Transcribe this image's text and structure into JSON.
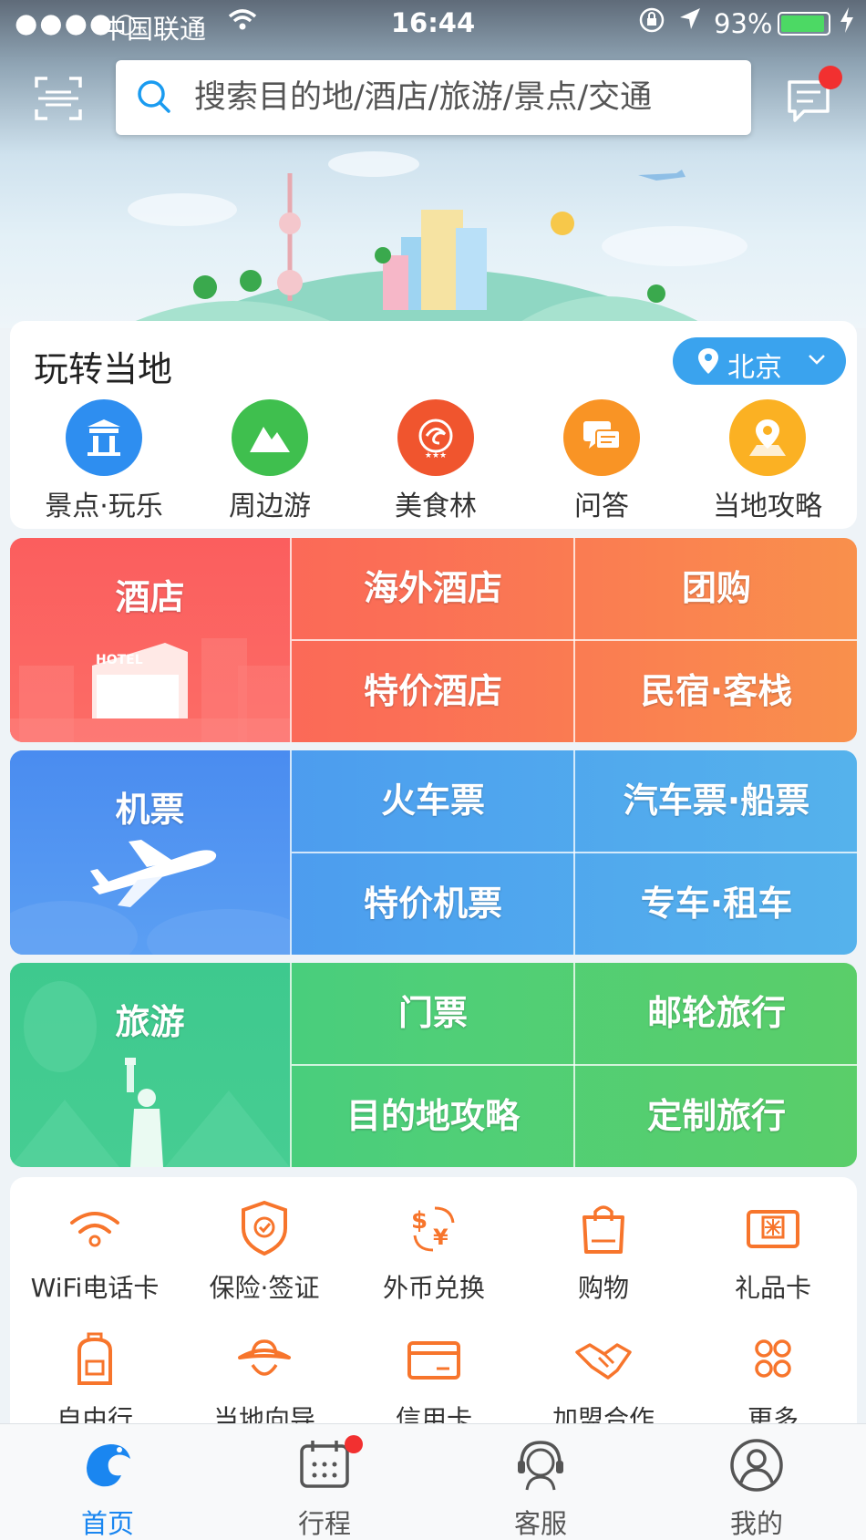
{
  "status_bar": {
    "signal": "●●●●○",
    "carrier": "中国联通",
    "time": "16:44",
    "battery": "93%",
    "battery_level": 0.93
  },
  "header": {
    "search_placeholder": "搜索目的地/酒店/旅游/景点/交通",
    "scan_icon": "scan-icon",
    "message_icon": "message-icon",
    "has_notification": true
  },
  "local": {
    "title": "玩转当地",
    "city": "北京",
    "items": [
      {
        "label": "景点·玩乐",
        "icon": "gate-icon",
        "color": "#2e8ef0"
      },
      {
        "label": "周边游",
        "icon": "mountain-icon",
        "color": "#3fbf4e"
      },
      {
        "label": "美食林",
        "icon": "dolphin-badge-icon",
        "color": "#f0552e"
      },
      {
        "label": "问答",
        "icon": "chat-bubbles-icon",
        "color": "#f99425"
      },
      {
        "label": "当地攻略",
        "icon": "map-pin-icon",
        "color": "#fbb123"
      }
    ]
  },
  "grid": {
    "hotel": {
      "main": "酒店",
      "cells": [
        "海外酒店",
        "团购",
        "特价酒店",
        "民宿·客栈"
      ]
    },
    "flight": {
      "main": "机票",
      "cells": [
        "火车票",
        "汽车票·船票",
        "特价机票",
        "专车·租车"
      ]
    },
    "travel": {
      "main": "旅游",
      "cells": [
        "门票",
        "邮轮旅行",
        "目的地攻略",
        "定制旅行"
      ]
    }
  },
  "services": [
    {
      "label": "WiFi电话卡",
      "icon": "wifi-icon"
    },
    {
      "label": "保险·签证",
      "icon": "shield-icon"
    },
    {
      "label": "外币兑换",
      "icon": "currency-exchange-icon"
    },
    {
      "label": "购物",
      "icon": "shopping-bag-icon"
    },
    {
      "label": "礼品卡",
      "icon": "gift-card-icon"
    },
    {
      "label": "自由行",
      "icon": "backpack-icon"
    },
    {
      "label": "当地向导",
      "icon": "guide-hat-icon"
    },
    {
      "label": "信用卡",
      "icon": "credit-card-icon"
    },
    {
      "label": "加盟合作",
      "icon": "handshake-icon"
    },
    {
      "label": "更多",
      "icon": "more-grid-icon"
    }
  ],
  "tabbar": {
    "items": [
      {
        "label": "首页",
        "icon": "home-dolphin-icon",
        "active": true
      },
      {
        "label": "行程",
        "icon": "calendar-icon",
        "badge": true
      },
      {
        "label": "客服",
        "icon": "headset-icon"
      },
      {
        "label": "我的",
        "icon": "profile-icon"
      }
    ]
  },
  "colors": {
    "accent": "#1a86f0",
    "hotel": "#fb6e56",
    "flight": "#4ea3ee",
    "travel": "#4fcf78",
    "service_orange": "#f7752c"
  }
}
